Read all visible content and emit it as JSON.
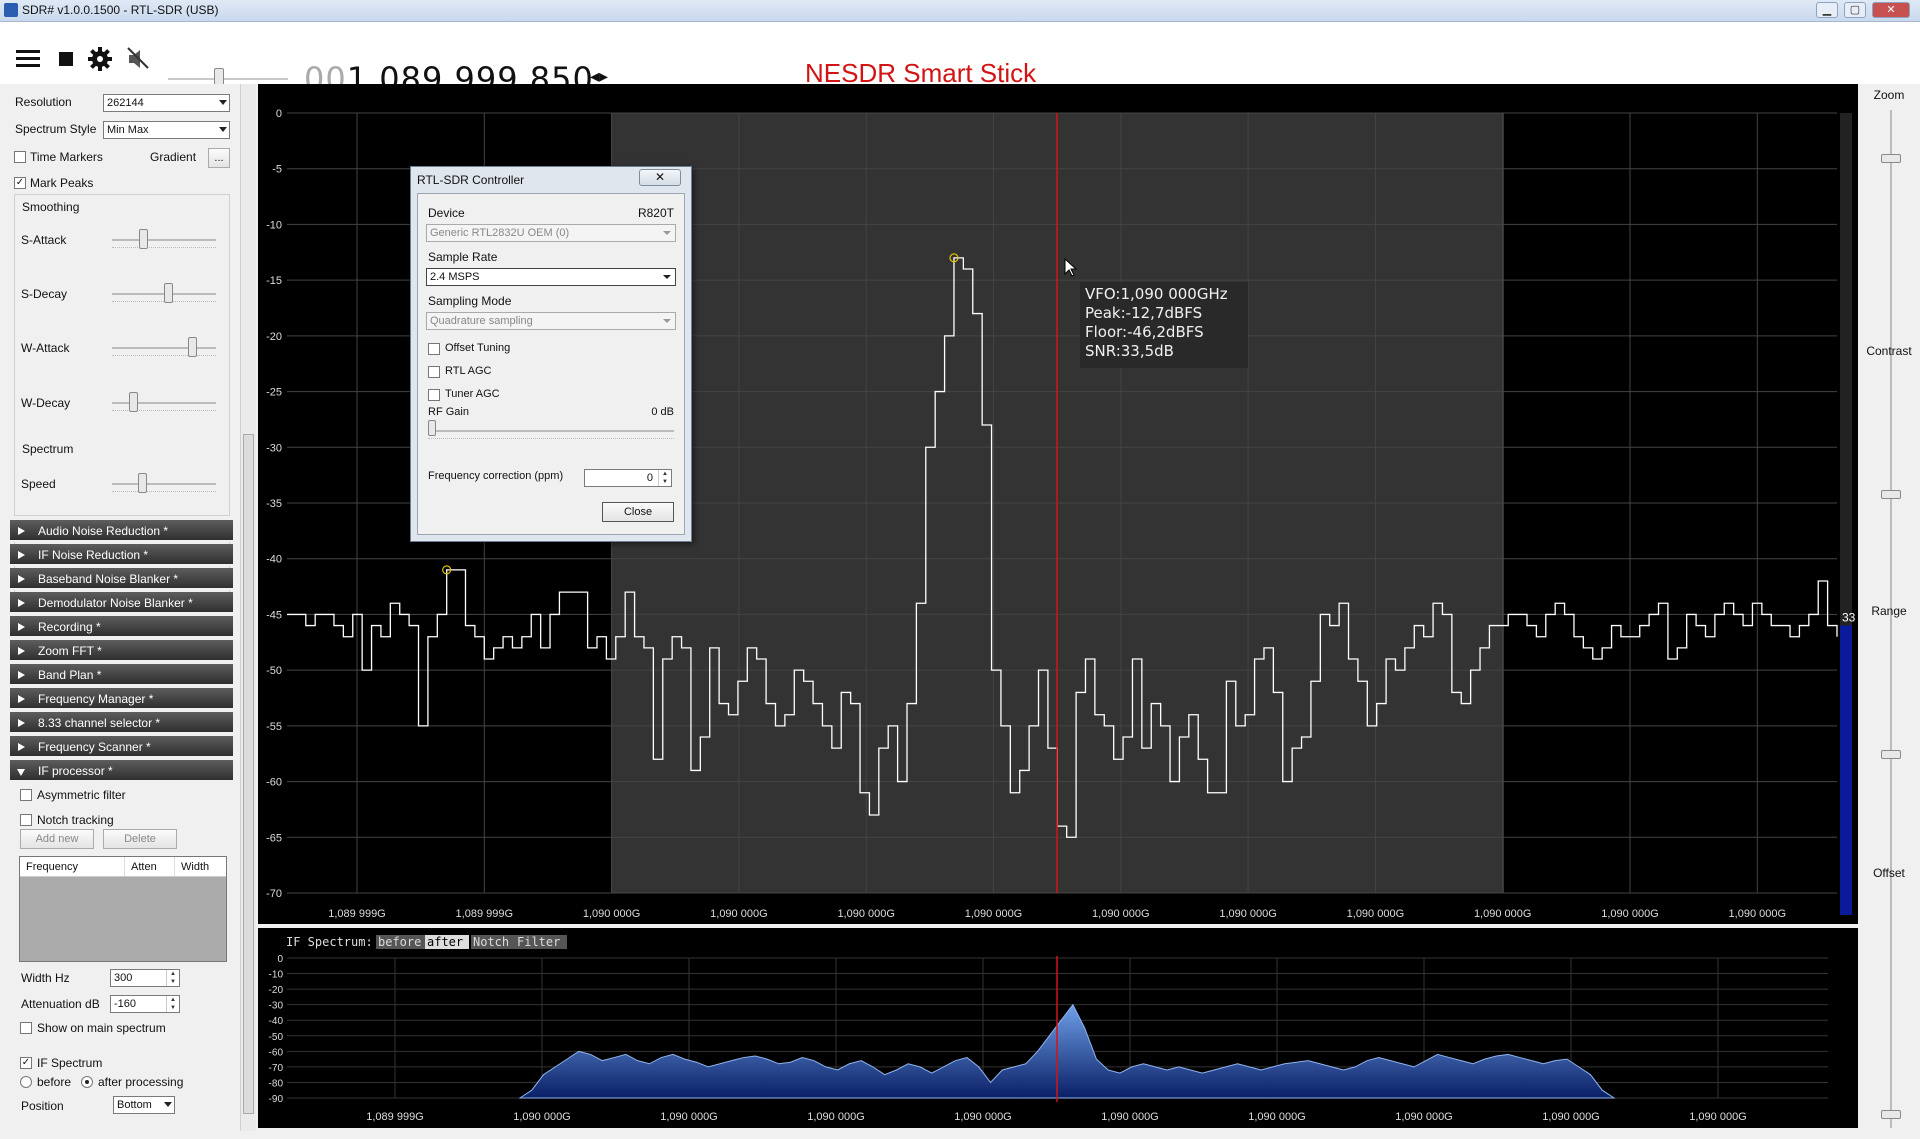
{
  "window": {
    "title": "SDR# v1.0.0.1500 - RTL-SDR (USB)"
  },
  "toolbar": {
    "freq_lead": "00",
    "freq_main": "1.089.999.850",
    "device_name": "NESDR Smart Stick"
  },
  "display": {
    "resolution_label": "Resolution",
    "resolution_value": "262144",
    "style_label": "Spectrum Style",
    "style_value": "Min Max",
    "time_markers": "Time Markers",
    "gradient": "Gradient",
    "gradient_btn": "...",
    "mark_peaks": "Mark Peaks",
    "smoothing": "Smoothing",
    "s_attack": "S-Attack",
    "s_decay": "S-Decay",
    "w_attack": "W-Attack",
    "w_decay": "W-Decay",
    "s_attack_level": 0.28,
    "s_decay_level": 0.55,
    "w_attack_level": 0.8,
    "w_decay_level": 0.18,
    "spectrum": "Spectrum",
    "speed": "Speed",
    "speed_level": 0.27
  },
  "plugins": [
    {
      "label": "Audio Noise Reduction *"
    },
    {
      "label": "IF Noise Reduction *"
    },
    {
      "label": "Baseband Noise Blanker *"
    },
    {
      "label": "Demodulator Noise Blanker *"
    },
    {
      "label": "Recording *"
    },
    {
      "label": "Zoom FFT *"
    },
    {
      "label": "Band Plan *"
    },
    {
      "label": "Frequency Manager *"
    },
    {
      "label": "8.33 channel selector *"
    },
    {
      "label": "Frequency Scanner *"
    },
    {
      "label": "IF processor *"
    }
  ],
  "if_processor": {
    "asym": "Asymmetric filter",
    "notch": "Notch tracking",
    "add": "Add new",
    "del": "Delete",
    "cols": [
      "Frequency",
      "Atten",
      "Width"
    ],
    "width_label": "Width Hz",
    "width_val": "300",
    "atten_label": "Attenuation dB",
    "atten_val": "-160",
    "show_main": "Show on main spectrum",
    "if_spectrum": "IF Spectrum",
    "before": "before",
    "after": "after processing",
    "position_label": "Position",
    "position_val": "Bottom"
  },
  "right": {
    "zoom": "Zoom",
    "contrast": "Contrast",
    "range": "Range",
    "offset": "Offset"
  },
  "tooltip": {
    "l1": "VFO:1,090 000GHz",
    "l2": "Peak:-12,7dBFS",
    "l3": "Floor:-46,2dBFS",
    "l4": "SNR:33,5dB"
  },
  "snr_badge": "33",
  "dialog": {
    "title": "RTL-SDR Controller",
    "close_x": "✕",
    "device_label": "Device",
    "device_tuner": "R820T",
    "device_val": "Generic RTL2832U OEM (0)",
    "rate_label": "Sample Rate",
    "rate_val": "2.4 MSPS",
    "mode_label": "Sampling Mode",
    "mode_val": "Quadrature sampling",
    "offset": "Offset Tuning",
    "rtl_agc": "RTL AGC",
    "tuner_agc": "Tuner AGC",
    "rf_gain": "RF Gain",
    "rf_gain_val": "0 dB",
    "fc_label": "Frequency correction (ppm)",
    "fc_val": "0",
    "close_btn": "Close"
  },
  "if_header": {
    "label": "IF Spectrum:",
    "before": "before",
    "after": "after",
    "notch": "Notch",
    "filter": "Filter"
  },
  "chart_data": [
    {
      "type": "line",
      "ylim": [
        -70,
        0
      ],
      "yticks": [
        "0",
        "-5",
        "-10",
        "-15",
        "-20",
        "-25",
        "-30",
        "-35",
        "-40",
        "-45",
        "-50",
        "-55",
        "-60",
        "-65",
        "-70"
      ],
      "xticks": [
        "1,089 999G",
        "1,089 999G",
        "1,090 000G",
        "1,090 000G",
        "1,090 000G",
        "1,090 000G",
        "1,090 000G",
        "1,090 000G",
        "1,090 000G",
        "1,090 000G",
        "1,090 000G",
        "1,090 000G"
      ],
      "values": [
        -45,
        -45,
        -46,
        -45,
        -45,
        -46,
        -47,
        -45,
        -50,
        -46,
        -47,
        -44,
        -45,
        -46,
        -55,
        -47,
        -45,
        -41,
        -41,
        -46,
        -47,
        -49,
        -48,
        -47,
        -48,
        -47,
        -45,
        -48,
        -45,
        -43,
        -43,
        -43,
        -48,
        -47,
        -49,
        -47,
        -43,
        -47,
        -48,
        -58,
        -49,
        -47,
        -48,
        -59,
        -56,
        -48,
        -53,
        -54,
        -51,
        -48,
        -49,
        -53,
        -55,
        -54,
        -50,
        -51,
        -53,
        -55,
        -57,
        -52,
        -53,
        -61,
        -63,
        -57,
        -55,
        -60,
        -53,
        -44,
        -30,
        -25,
        -20,
        -13,
        -14,
        -18,
        -28,
        -50,
        -55,
        -61,
        -59,
        -55,
        -50,
        -57,
        -64,
        -65,
        -52,
        -49,
        -54,
        -55,
        -58,
        -56,
        -49,
        -57,
        -53,
        -55,
        -60,
        -56,
        -54,
        -58,
        -61,
        -61,
        -51,
        -55,
        -54,
        -49,
        -48,
        -52,
        -60,
        -57,
        -56,
        -51,
        -45,
        -46,
        -44,
        -49,
        -51,
        -55,
        -53,
        -49,
        -50,
        -48,
        -46,
        -47,
        -44,
        -45,
        -52,
        -53,
        -50,
        -48,
        -46,
        -46,
        -45,
        -45,
        -46,
        -47,
        -45,
        -44,
        -45,
        -47,
        -48,
        -49,
        -48,
        -46,
        -47,
        -47,
        -46,
        -45,
        -44,
        -49,
        -48,
        -45,
        -46,
        -47,
        -45,
        -44,
        -45,
        -46,
        -44,
        -45,
        -46,
        -46,
        -47,
        -46,
        -45,
        -42,
        -46,
        -47
      ],
      "peaks": [
        {
          "x": 17,
          "y": -41
        },
        {
          "x": 71,
          "y": -13
        },
        {
          "x": 166,
          "y": -42
        }
      ]
    },
    {
      "type": "area",
      "ylim": [
        -90,
        0
      ],
      "yticks": [
        "0",
        "-10",
        "-20",
        "-30",
        "-40",
        "-50",
        "-60",
        "-70",
        "-80",
        "-90"
      ],
      "xticks": [
        "1,089 999G",
        "1,090 000G",
        "1,090 000G",
        "1,090 000G",
        "1,090 000G",
        "1,090 000G",
        "1,090 000G",
        "1,090 000G",
        "1,090 000G",
        "1,090 000G"
      ],
      "values": [
        -90,
        -85,
        -75,
        -70,
        -65,
        -60,
        -62,
        -66,
        -64,
        -62,
        -66,
        -68,
        -64,
        -62,
        -65,
        -67,
        -70,
        -68,
        -66,
        -64,
        -63,
        -65,
        -68,
        -67,
        -64,
        -66,
        -70,
        -72,
        -68,
        -66,
        -70,
        -75,
        -72,
        -68,
        -70,
        -74,
        -70,
        -66,
        -64,
        -70,
        -80,
        -72,
        -70,
        -68,
        -60,
        -50,
        -40,
        -30,
        -45,
        -65,
        -72,
        -74,
        -70,
        -68,
        -70,
        -72,
        -70,
        -72,
        -74,
        -72,
        -70,
        -68,
        -70,
        -72,
        -70,
        -68,
        -67,
        -66,
        -68,
        -70,
        -72,
        -70,
        -66,
        -64,
        -66,
        -68,
        -70,
        -66,
        -62,
        -64,
        -66,
        -68,
        -65,
        -63,
        -62,
        -64,
        -66,
        -68,
        -66,
        -65,
        -70,
        -75,
        -85,
        -90
      ]
    }
  ]
}
